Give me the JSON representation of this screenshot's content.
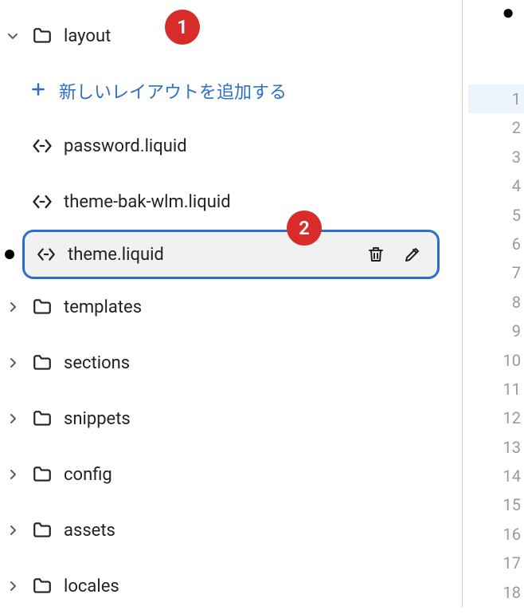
{
  "badges": {
    "one": "1",
    "two": "2"
  },
  "tree": {
    "layout": {
      "label": "layout",
      "add_label": "新しいレイアウトを追加する"
    },
    "files": {
      "password": "password.liquid",
      "theme_bak": "theme-bak-wlm.liquid",
      "theme": "theme.liquid"
    },
    "folders": {
      "templates": "templates",
      "sections": "sections",
      "snippets": "snippets",
      "config": "config",
      "assets": "assets",
      "locales": "locales"
    }
  },
  "gutter": {
    "lines": [
      "1",
      "2",
      "3",
      "4",
      "5",
      "6",
      "7",
      "8",
      "9",
      "10",
      "11",
      "12",
      "13",
      "14",
      "15",
      "16",
      "17",
      "18"
    ]
  }
}
